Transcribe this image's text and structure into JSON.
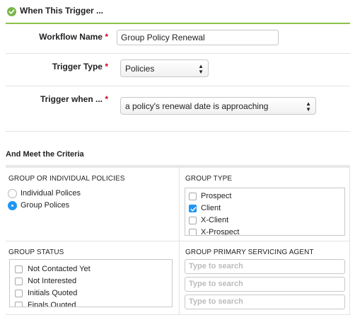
{
  "header": {
    "title": "When This Trigger ..."
  },
  "form": {
    "workflow_name": {
      "label": "Workflow Name",
      "value": "Group Policy Renewal"
    },
    "trigger_type": {
      "label": "Trigger Type",
      "value": "Policies"
    },
    "trigger_when": {
      "label": "Trigger when ...",
      "value": "a policy's renewal date is approaching"
    },
    "required_mark": "*"
  },
  "criteria": {
    "title": "And Meet the Criteria",
    "group_or_individual": {
      "title": "GROUP OR INDIVIDUAL POLICIES",
      "options": [
        {
          "label": "Individual Polices",
          "selected": false
        },
        {
          "label": "Group Polices",
          "selected": true
        }
      ]
    },
    "group_type": {
      "title": "GROUP TYPE",
      "options": [
        {
          "label": "Prospect",
          "checked": false
        },
        {
          "label": "Client",
          "checked": true
        },
        {
          "label": "X-Client",
          "checked": false
        },
        {
          "label": "X-Prospect",
          "checked": false
        }
      ]
    },
    "group_status": {
      "title": "GROUP STATUS",
      "options": [
        {
          "label": "Not Contacted Yet",
          "checked": false
        },
        {
          "label": "Not Interested",
          "checked": false
        },
        {
          "label": "Initials Quoted",
          "checked": false
        },
        {
          "label": "Finals Quoted",
          "checked": false
        }
      ]
    },
    "primary_agent": {
      "title": "GROUP PRIMARY SERVICING AGENT",
      "search_placeholder": "Type to search"
    }
  },
  "colors": {
    "accent_green": "#8bc34a",
    "check_blue": "#2196f3",
    "required_red": "#d0021b"
  },
  "icons": {
    "header": "check-circle-icon",
    "select": "updown-arrows-icon",
    "checkbox": "checkmark-icon"
  }
}
